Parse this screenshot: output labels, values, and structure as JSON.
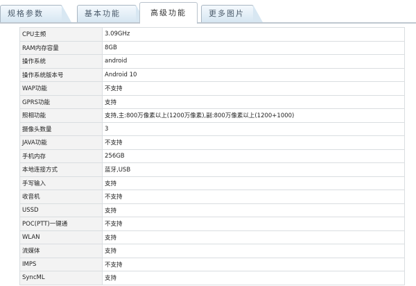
{
  "tabs": [
    {
      "label": "规格参数",
      "active": false
    },
    {
      "label": "基本功能",
      "active": false
    },
    {
      "label": "高级功能",
      "active": true
    },
    {
      "label": "更多图片",
      "active": false
    }
  ],
  "specs": [
    {
      "label": "CPU主频",
      "value": "3.09GHz"
    },
    {
      "label": "RAM内存容量",
      "value": "8GB"
    },
    {
      "label": "操作系统",
      "value": "android"
    },
    {
      "label": "操作系统版本号",
      "value": "Android 10"
    },
    {
      "label": "WAP功能",
      "value": "不支持"
    },
    {
      "label": "GPRS功能",
      "value": "支持"
    },
    {
      "label": "照相功能",
      "value": "支持,主:800万像素以上(1200万像素),副:800万像素以上(1200+1000)"
    },
    {
      "label": "摄像头数量",
      "value": "3"
    },
    {
      "label": "JAVA功能",
      "value": "不支持"
    },
    {
      "label": "手机内存",
      "value": "256GB"
    },
    {
      "label": "本地连接方式",
      "value": "蓝牙,USB"
    },
    {
      "label": "手写输入",
      "value": "支持"
    },
    {
      "label": "收音机",
      "value": "不支持"
    },
    {
      "label": "USSD",
      "value": "支持"
    },
    {
      "label": "POC(PTT)一键通",
      "value": "不支持"
    },
    {
      "label": "WLAN",
      "value": "支持"
    },
    {
      "label": "流媒体",
      "value": "支持"
    },
    {
      "label": "IMPS",
      "value": "不支持"
    },
    {
      "label": "SyncML",
      "value": "支持"
    }
  ]
}
